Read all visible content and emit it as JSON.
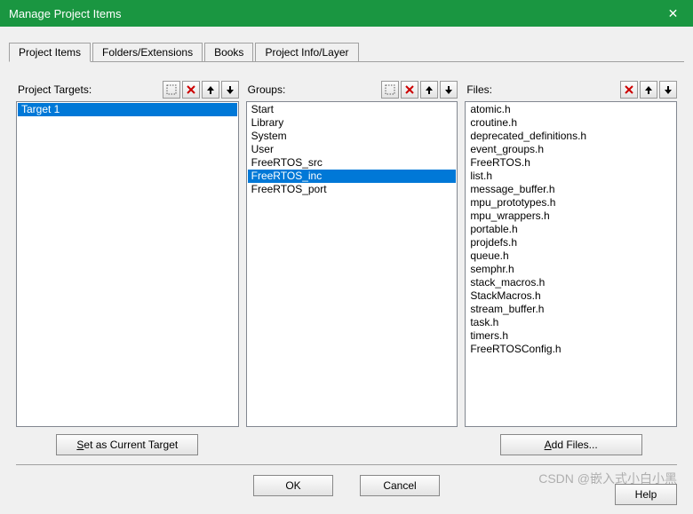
{
  "window": {
    "title": "Manage Project Items",
    "close": "✕"
  },
  "tabs": {
    "t1": "Project Items",
    "t2": "Folders/Extensions",
    "t3": "Books",
    "t4": "Project Info/Layer"
  },
  "targets": {
    "label": "Project Targets:",
    "items": [
      "Target 1"
    ],
    "button": "Set as Current Target"
  },
  "groups": {
    "label": "Groups:",
    "items": [
      "Start",
      "Library",
      "System",
      "User",
      "FreeRTOS_src",
      "FreeRTOS_inc",
      "FreeRTOS_port"
    ]
  },
  "files": {
    "label": "Files:",
    "items": [
      "atomic.h",
      "croutine.h",
      "deprecated_definitions.h",
      "event_groups.h",
      "FreeRTOS.h",
      "list.h",
      "message_buffer.h",
      "mpu_prototypes.h",
      "mpu_wrappers.h",
      "portable.h",
      "projdefs.h",
      "queue.h",
      "semphr.h",
      "stack_macros.h",
      "StackMacros.h",
      "stream_buffer.h",
      "task.h",
      "timers.h",
      "FreeRTOSConfig.h"
    ],
    "button": "Add Files..."
  },
  "buttons": {
    "ok": "OK",
    "cancel": "Cancel",
    "help": "Help"
  },
  "watermark": "CSDN @嵌入式小白小黑"
}
